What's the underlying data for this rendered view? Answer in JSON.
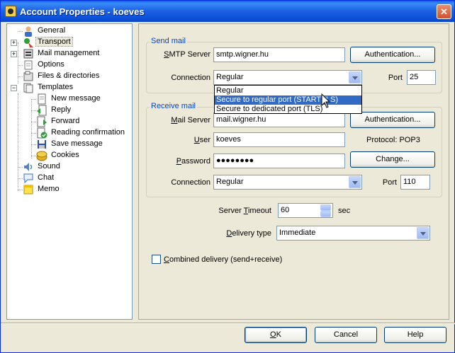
{
  "window": {
    "title": "Account Properties - koeves",
    "close_glyph": "✕"
  },
  "tree": {
    "items": [
      {
        "label": "General",
        "icon": "user-icon"
      },
      {
        "label": "Transport",
        "icon": "transport-icon"
      },
      {
        "label": "Mail management",
        "icon": "mail-management-icon"
      },
      {
        "label": "Options",
        "icon": "options-icon"
      },
      {
        "label": "Files & directories",
        "icon": "files-icon"
      },
      {
        "label": "Templates",
        "icon": "templates-icon"
      },
      {
        "label": "New message",
        "icon": "new-message-icon"
      },
      {
        "label": "Reply",
        "icon": "reply-icon"
      },
      {
        "label": "Forward",
        "icon": "forward-icon"
      },
      {
        "label": "Reading confirmation",
        "icon": "reading-confirmation-icon"
      },
      {
        "label": "Save message",
        "icon": "save-icon"
      },
      {
        "label": "Cookies",
        "icon": "cookies-icon"
      },
      {
        "label": "Sound",
        "icon": "sound-icon"
      },
      {
        "label": "Chat",
        "icon": "chat-icon"
      },
      {
        "label": "Memo",
        "icon": "memo-icon"
      }
    ],
    "expand_glyph": "+",
    "collapse_glyph": "−"
  },
  "send_mail": {
    "legend": "Send mail",
    "smtp_label_pre": "",
    "smtp_label_u": "S",
    "smtp_label_post": "MTP Server",
    "smtp_value": "smtp.wigner.hu",
    "auth_button": "Authentication...",
    "connection_label": "Connection",
    "connection_value": "Regular",
    "port_label": "Port",
    "port_value": "25",
    "dropdown_options": [
      "Regular",
      "Secure to regular port (STARTTLS)",
      "Secure to dedicated port (TLS)"
    ]
  },
  "receive_mail": {
    "legend": "Receive mail",
    "server_label_u": "M",
    "server_label_post": "ail Server",
    "server_value": "mail.wigner.hu",
    "auth_button": "Authentication...",
    "user_label_u": "U",
    "user_label_post": "ser",
    "user_value": "koeves",
    "protocol_text": "Protocol:  POP3",
    "password_label_u": "P",
    "password_label_post": "assword",
    "password_value": "●●●●●●●●",
    "change_button": "Change...",
    "connection_label": "Connection",
    "connection_value": "Regular",
    "port_label": "Port",
    "port_value": "110"
  },
  "options": {
    "timeout_label_pre": "Server ",
    "timeout_label_u": "T",
    "timeout_label_post": "imeout",
    "timeout_value": "60",
    "timeout_unit": "sec",
    "delivery_label_u": "D",
    "delivery_label_post": "elivery type",
    "delivery_value": "Immediate",
    "combined_label_u": "C",
    "combined_label_post": "ombined delivery (send+receive)",
    "combined_checked": false
  },
  "footer": {
    "ok_u": "O",
    "ok_post": "K",
    "cancel": "Cancel",
    "help": "Help"
  }
}
